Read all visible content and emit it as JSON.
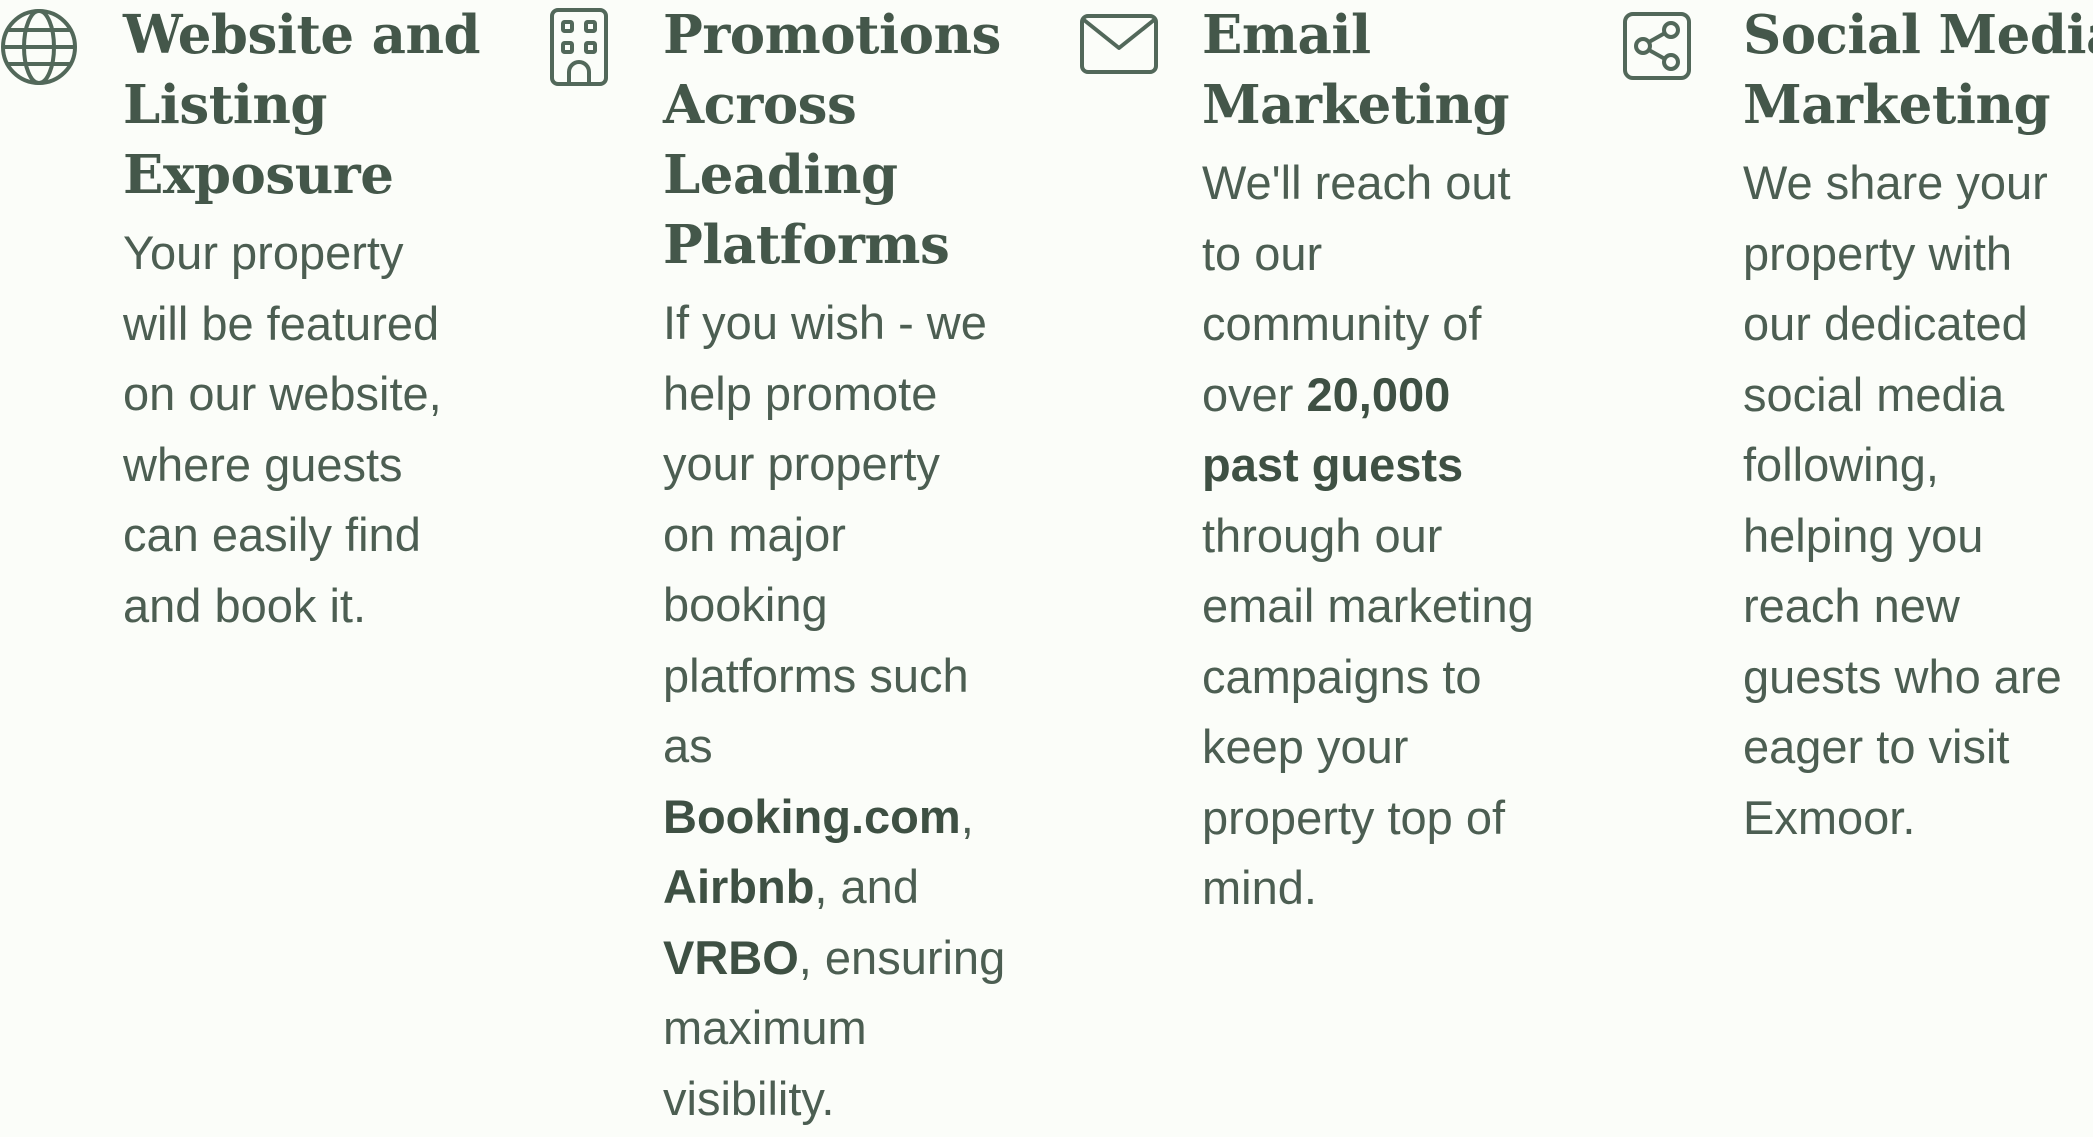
{
  "features": [
    {
      "icon": "globe-icon",
      "title": "Website and\nListing\nExposure",
      "body": "Your property\nwill be featured\non our website,\nwhere guests\ncan easily find\nand book it."
    },
    {
      "icon": "building-icon",
      "title": "Promotions\nAcross\nLeading\nPlatforms",
      "body_before": "If you wish - we\nhelp promote\nyour property\non major\nbooking\nplatforms such\nas\n",
      "platform_1": "Booking.com",
      "sep_1": ",\n",
      "platform_2": "Airbnb",
      "sep_2": ", and\n",
      "platform_3": "VRBO",
      "body_after": ", ensuring\nmaximum\nvisibility."
    },
    {
      "icon": "envelope-icon",
      "title": "Email\nMarketing",
      "body_before": "We'll reach out\nto our\ncommunity of\nover ",
      "highlight": "20,000\npast guests",
      "body_after": "\nthrough our\nemail marketing\ncampaigns to\nkeep your\nproperty top of\nmind."
    },
    {
      "icon": "share-icon",
      "title": "Social Media\nMarketing",
      "body": "We share your\nproperty with\nour dedicated\nsocial media\nfollowing,\nhelping you\nreach new\nguests who are\neager to visit\nExmoor."
    }
  ]
}
